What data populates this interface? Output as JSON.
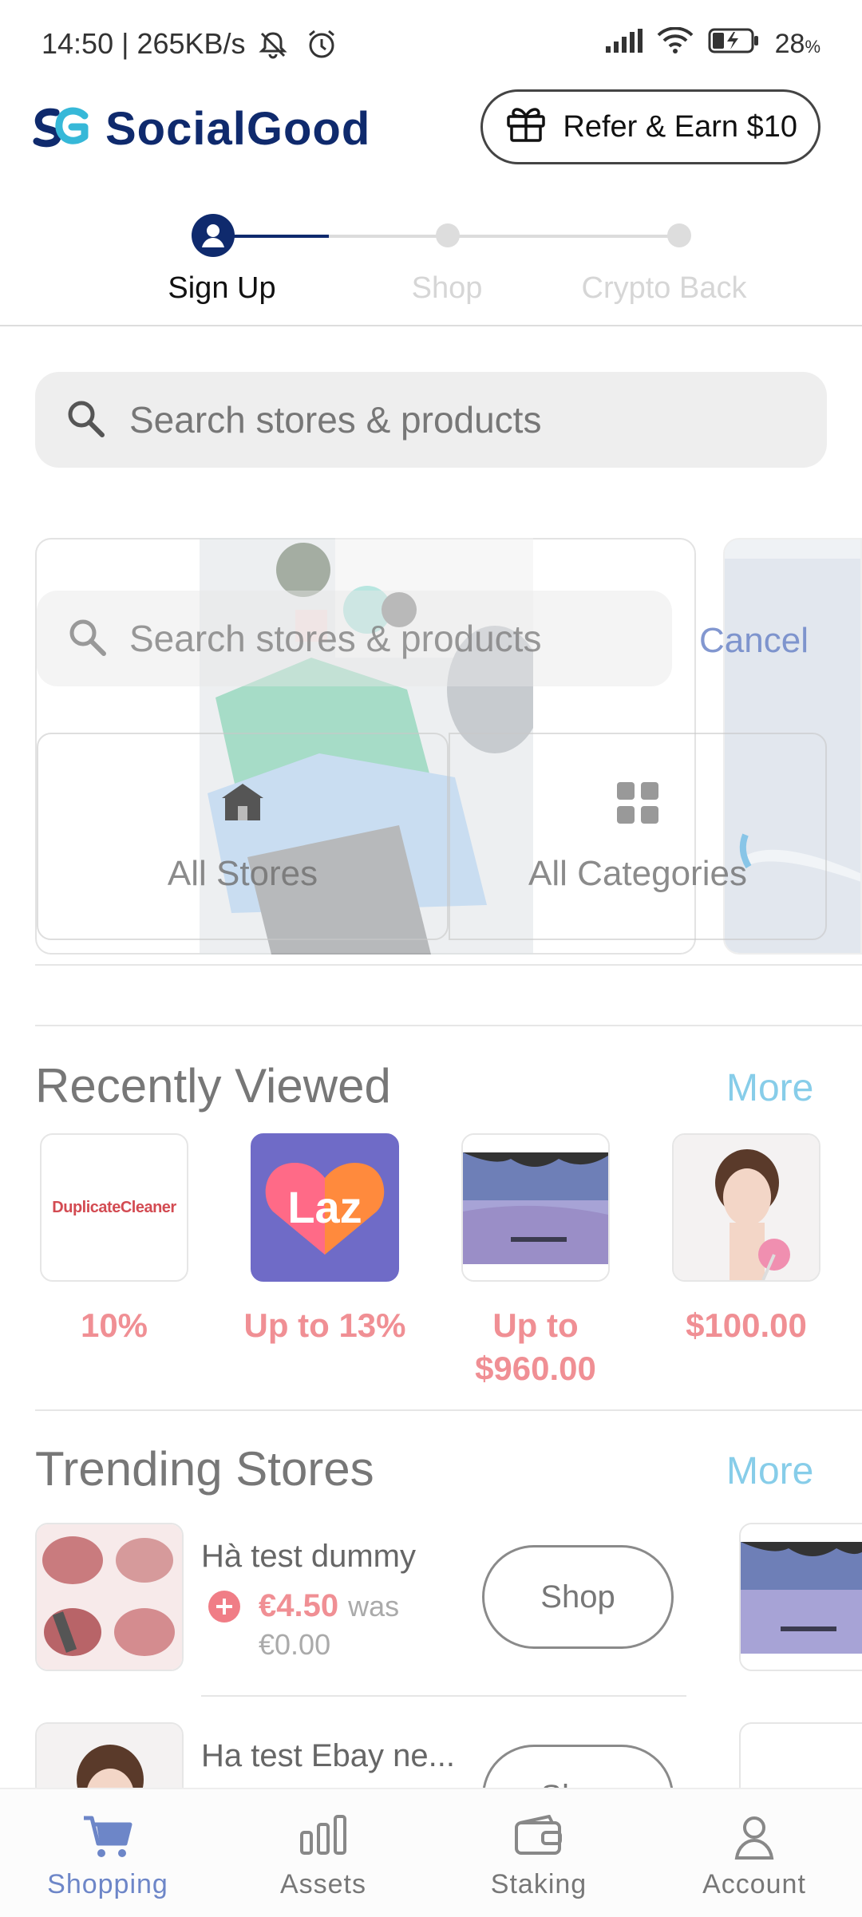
{
  "status_bar": {
    "time_speed": "14:50 | 265KB/s",
    "battery": "28",
    "battery_unit": "%"
  },
  "header": {
    "logo_text": "SocialGood",
    "refer_label": "Refer & Earn $10"
  },
  "stepper": {
    "steps": [
      {
        "label": "Sign Up"
      },
      {
        "label": "Shop"
      },
      {
        "label": "Crypto Back"
      }
    ],
    "active_index": 0
  },
  "search": {
    "placeholder": "Search stores & products"
  },
  "overlay": {
    "search_placeholder": "Search stores & products",
    "cancel_label": "Cancel",
    "all_stores_label": "All Stores",
    "all_categories_label": "All Categories"
  },
  "recently_viewed": {
    "title": "Recently Viewed",
    "more_label": "More",
    "items": [
      {
        "logo_text": "DuplicateCleaner",
        "label": "10%"
      },
      {
        "logo_text": "Laz",
        "label": "Up to 13%"
      },
      {
        "label": "Up to $960.00"
      },
      {
        "label": "$100.00"
      }
    ]
  },
  "trending_stores": {
    "title": "Trending Stores",
    "more_label": "More",
    "items": [
      {
        "name": "Hà test dummy",
        "price": "€4.50",
        "was_label": "was",
        "was_price": "€0.00",
        "shop_label": "Shop"
      },
      {
        "name": "Ha test Ebay ne...",
        "shop_label": "Shop"
      }
    ]
  },
  "bottom_nav": {
    "items": [
      {
        "label": "Shopping"
      },
      {
        "label": "Assets"
      },
      {
        "label": "Staking"
      },
      {
        "label": "Account"
      }
    ],
    "active_index": 0
  },
  "colors": {
    "brand_navy": "#0f2a6d",
    "brand_cyan": "#36b8d8",
    "accent_pink": "#f08f94",
    "more_blue": "#87cde9",
    "nav_active": "#6d86c8"
  }
}
